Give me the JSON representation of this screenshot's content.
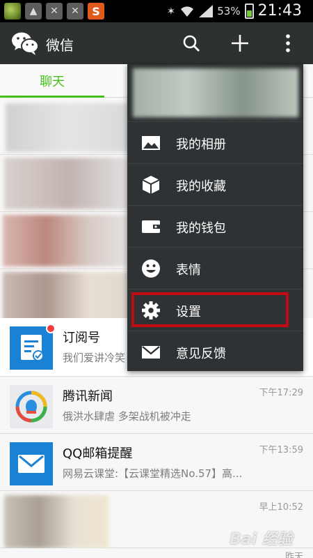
{
  "status_bar": {
    "battery": "53%",
    "time": "21:43",
    "notification_icons": [
      "app-icon",
      "image-icon",
      "no-signal-icon",
      "no-signal-icon",
      "s-app-icon"
    ]
  },
  "action_bar": {
    "title": "微信",
    "icons": [
      "wechat-logo",
      "search-icon",
      "plus-icon",
      "more-icon"
    ]
  },
  "tabs": {
    "active": "聊天"
  },
  "conversations": [
    {
      "title": "订阅号",
      "subtitle": "我们爱讲冷笑",
      "time": "",
      "avatar": "subscription-icon",
      "unread_dot": true
    },
    {
      "title": "腾讯新闻",
      "subtitle": "俄洪水肆虐 多架战机被冲走",
      "time": "下午17:29",
      "avatar": "tencent-news-icon"
    },
    {
      "title": "QQ邮箱提醒",
      "subtitle": "网易云课堂:【云课堂精选No.57】高...",
      "time": "下午13:59",
      "avatar": "mail-icon"
    },
    {
      "title": "",
      "subtitle": "",
      "time": "早上10:52",
      "avatar": "blurred"
    },
    {
      "title": "",
      "subtitle": "",
      "time": "昨天",
      "avatar": "blurred"
    }
  ],
  "menu": {
    "items": [
      {
        "label": "我的相册",
        "icon": "photo-icon"
      },
      {
        "label": "我的收藏",
        "icon": "cube-icon"
      },
      {
        "label": "我的钱包",
        "icon": "wallet-icon"
      },
      {
        "label": "表情",
        "icon": "smiley-icon"
      },
      {
        "label": "设置",
        "icon": "gear-icon",
        "highlighted": true
      },
      {
        "label": "意见反馈",
        "icon": "envelope-icon"
      }
    ],
    "highlight_color": "#c00a12"
  },
  "colors": {
    "accent": "#45c01a",
    "action_bar": "#2e3132",
    "menu_bg": "#2f3234"
  },
  "watermark": "Bai 经验"
}
